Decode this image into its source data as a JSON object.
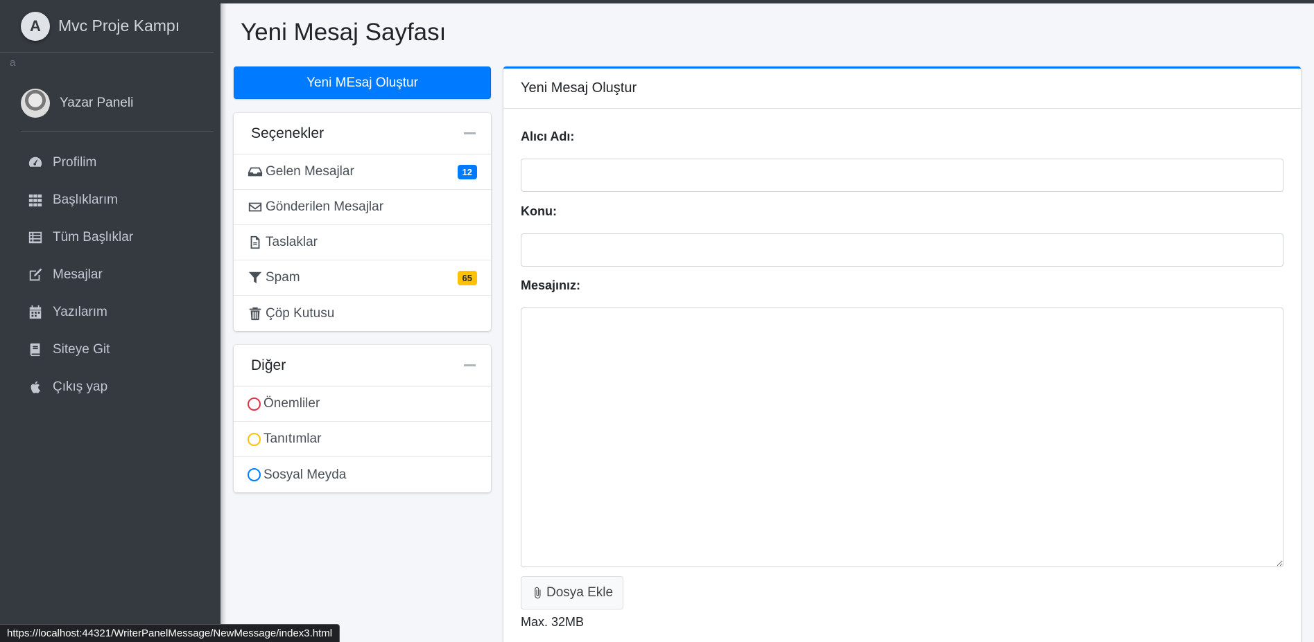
{
  "sidebar": {
    "brand": "Mvc Proje Kampı",
    "stray_text": "a",
    "user_name": "Yazar Paneli",
    "nav": [
      {
        "label": "Profilim",
        "icon": "tachometer-icon"
      },
      {
        "label": "Başlıklarım",
        "icon": "grid-icon"
      },
      {
        "label": "Tüm Başlıklar",
        "icon": "list-icon"
      },
      {
        "label": "Mesajlar",
        "icon": "edit-icon"
      },
      {
        "label": "Yazılarım",
        "icon": "calendar-icon"
      },
      {
        "label": "Siteye Git",
        "icon": "book-icon"
      },
      {
        "label": "Çıkış yap",
        "icon": "apple-icon"
      }
    ]
  },
  "page": {
    "title": "Yeni Mesaj Sayfası"
  },
  "compose_button": "Yeni MEsaj Oluştur",
  "options_card": {
    "title": "Seçenekler",
    "items": [
      {
        "label": "Gelen Mesajlar",
        "badge": "12",
        "icon": "inbox-icon"
      },
      {
        "label": "Gönderilen Mesajlar",
        "badge": null,
        "icon": "envelope-icon"
      },
      {
        "label": "Taslaklar",
        "badge": null,
        "icon": "file-icon"
      },
      {
        "label": "Spam",
        "badge": "65",
        "icon": "filter-icon"
      },
      {
        "label": "Çöp Kutusu",
        "badge": null,
        "icon": "trash-icon"
      }
    ]
  },
  "other_card": {
    "title": "Diğer",
    "items": [
      {
        "label": "Önemliler",
        "color": "#dc3545"
      },
      {
        "label": "Tanıtımlar",
        "color": "#ffc107"
      },
      {
        "label": "Sosyal Meyda",
        "color": "#007bff"
      }
    ]
  },
  "compose_form": {
    "header": "Yeni Mesaj Oluştur",
    "recipient_label": "Alıcı Adı:",
    "recipient_value": "",
    "subject_label": "Konu:",
    "subject_value": "",
    "message_label": "Mesajınız:",
    "message_value": "",
    "attach_label": "Dosya Ekle",
    "max_size": "Max. 32MB"
  },
  "status_bar": {
    "url": "https://localhost:44321/WriterPanelMessage/NewMessage/index3.html"
  },
  "colors": {
    "primary": "#007bff",
    "warning": "#ffc107",
    "danger": "#dc3545",
    "sidebar": "#343a40"
  }
}
